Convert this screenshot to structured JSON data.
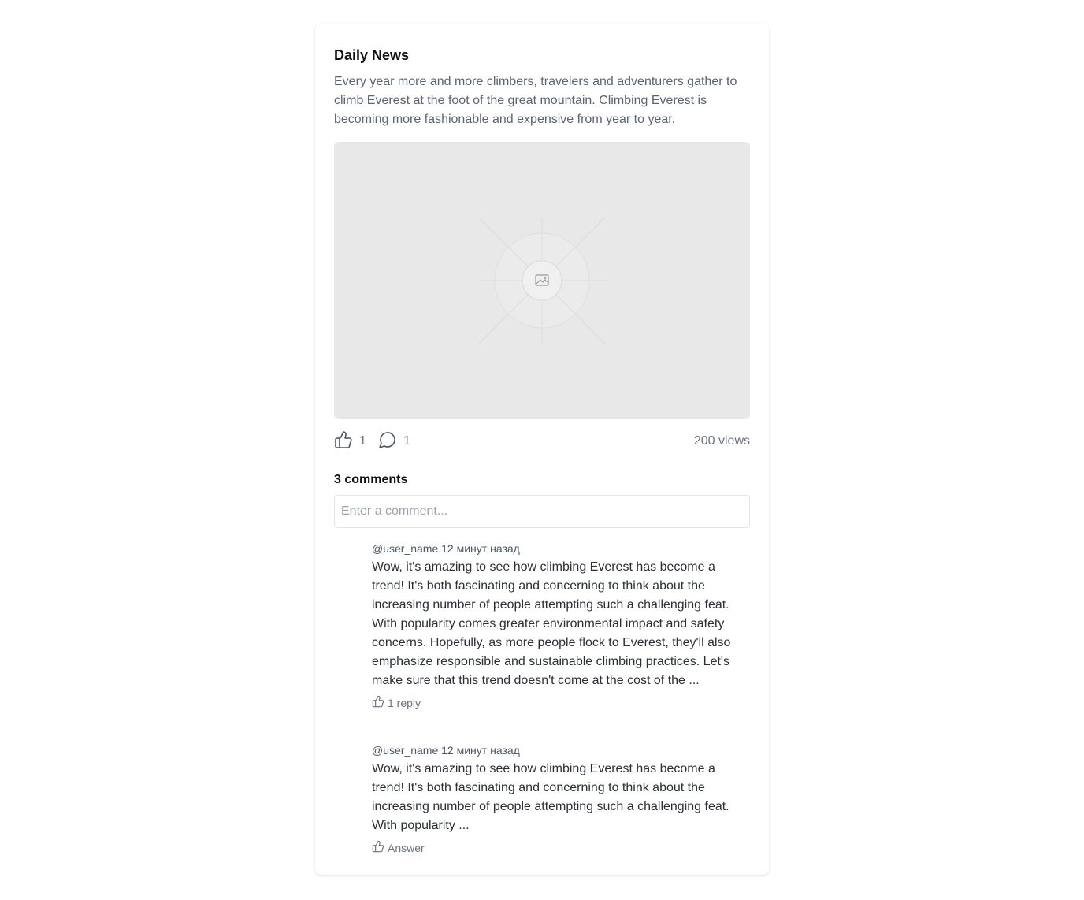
{
  "post": {
    "title": "Daily News",
    "description": "Every year more and more climbers, travelers and adventurers gather to climb Everest at the foot of the great mountain. Climbing Everest is becoming more fashionable and expensive from year to year.",
    "image_icon": "image-placeholder-icon",
    "likes": "1",
    "comments_count": "1",
    "views": "200 views"
  },
  "comments_section": {
    "title": "3 comments",
    "input_placeholder": "Enter a comment...",
    "items": [
      {
        "meta": "@user_name 12 минут назад",
        "text": "Wow, it's amazing to see how climbing Everest has become a trend! It's both fascinating and concerning to think about the increasing number of people attempting such a challenging feat. With popularity comes greater environmental impact and safety concerns. Hopefully, as more people flock to Everest, they'll also emphasize responsible and sustainable climbing practices. Let's make sure that this trend doesn't come at the cost of the ...",
        "action": "1 reply"
      },
      {
        "meta": "@user_name 12 минут назад",
        "text": "Wow, it's amazing to see how climbing Everest has become a trend! It's both fascinating and concerning to think about the increasing number of people attempting such a challenging feat. With popularity ...",
        "action": "Answer"
      }
    ]
  },
  "icons": {
    "like": "thumbs-up-icon",
    "comment": "speech-bubble-icon"
  },
  "colors": {
    "text_primary": "#111111",
    "text_muted": "#6b7280",
    "placeholder_bg": "#e8e8e8"
  }
}
